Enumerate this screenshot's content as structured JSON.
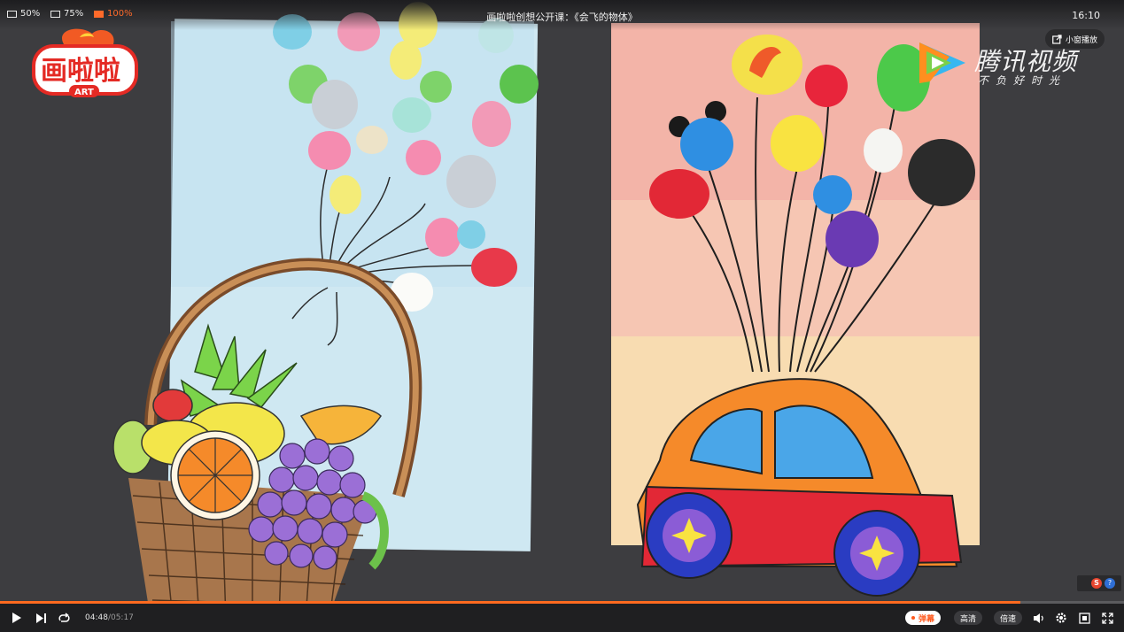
{
  "player": {
    "title": "画啦啦创想公开课：《会飞的物体》",
    "clock": "16:10",
    "zoom_options": [
      {
        "label": "50%",
        "active": false
      },
      {
        "label": "75%",
        "active": false
      },
      {
        "label": "100%",
        "active": true
      }
    ],
    "mini_window_label": "小窗播放",
    "current_time": "04:48",
    "duration": "/05:17",
    "progress_fraction": 0.908,
    "danmu_label": "弹幕",
    "quality_label": "高清",
    "speed_label": "倍速",
    "accent_color": "#ff6a1f"
  },
  "video": {
    "logo_text": "画啦啦",
    "logo_subtext": "ART",
    "watermark_brand": "腾讯视频",
    "watermark_slogan": "不负好时光"
  },
  "icons": [
    "play-icon",
    "next-icon",
    "loop-icon",
    "volume-icon",
    "settings-icon",
    "fullscreen-icon",
    "webfullscreen-icon",
    "popout-icon"
  ]
}
